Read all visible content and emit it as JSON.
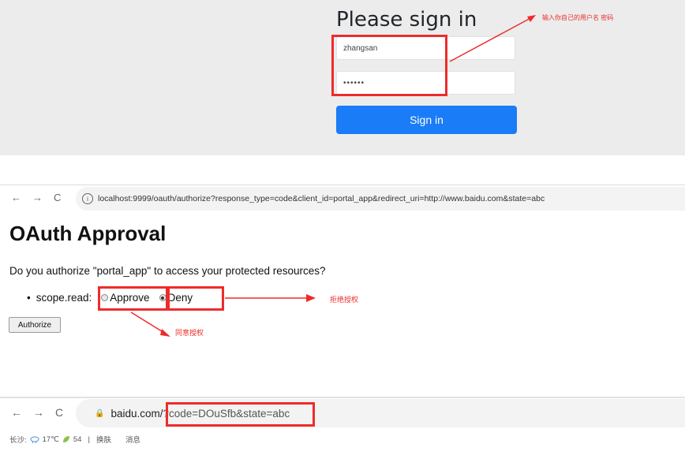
{
  "login": {
    "title": "Please sign in",
    "username_value": "zhangsan",
    "password_value": "••••••",
    "signin_label": "Sign in",
    "annotation": "输入你自己的用户名 密码"
  },
  "approval": {
    "nav_back": "←",
    "nav_forward": "→",
    "nav_reload": "C",
    "info_icon": "i",
    "url": "localhost:9999/oauth/authorize?response_type=code&client_id=portal_app&redirect_uri=http://www.baidu.com&state=abc",
    "title": "OAuth Approval",
    "question": "Do you authorize \"portal_app\" to access your protected resources?",
    "scope_bullet": "•",
    "scope_label": "scope.read:",
    "approve_label": "Approve",
    "deny_label": "Deny",
    "selected": "Deny",
    "authorize_label": "Authorize",
    "annotation_deny": "拒绝授权",
    "annotation_approve": "同意授权"
  },
  "redirect": {
    "nav_back": "←",
    "nav_forward": "→",
    "nav_reload": "C",
    "lock_icon": "🔒",
    "url_host": "baidu.com/",
    "url_query": "?code=DOuSfb&state=abc",
    "weather_city": "长沙:",
    "weather_temp": "17℃",
    "aqi_value": "54",
    "weather_separator": "|",
    "link_skin": "换肤",
    "link_news": "消息"
  },
  "colors": {
    "annotation_red": "#ee2b2b",
    "signin_blue": "#1a7cf7",
    "login_bg": "#ececec"
  }
}
